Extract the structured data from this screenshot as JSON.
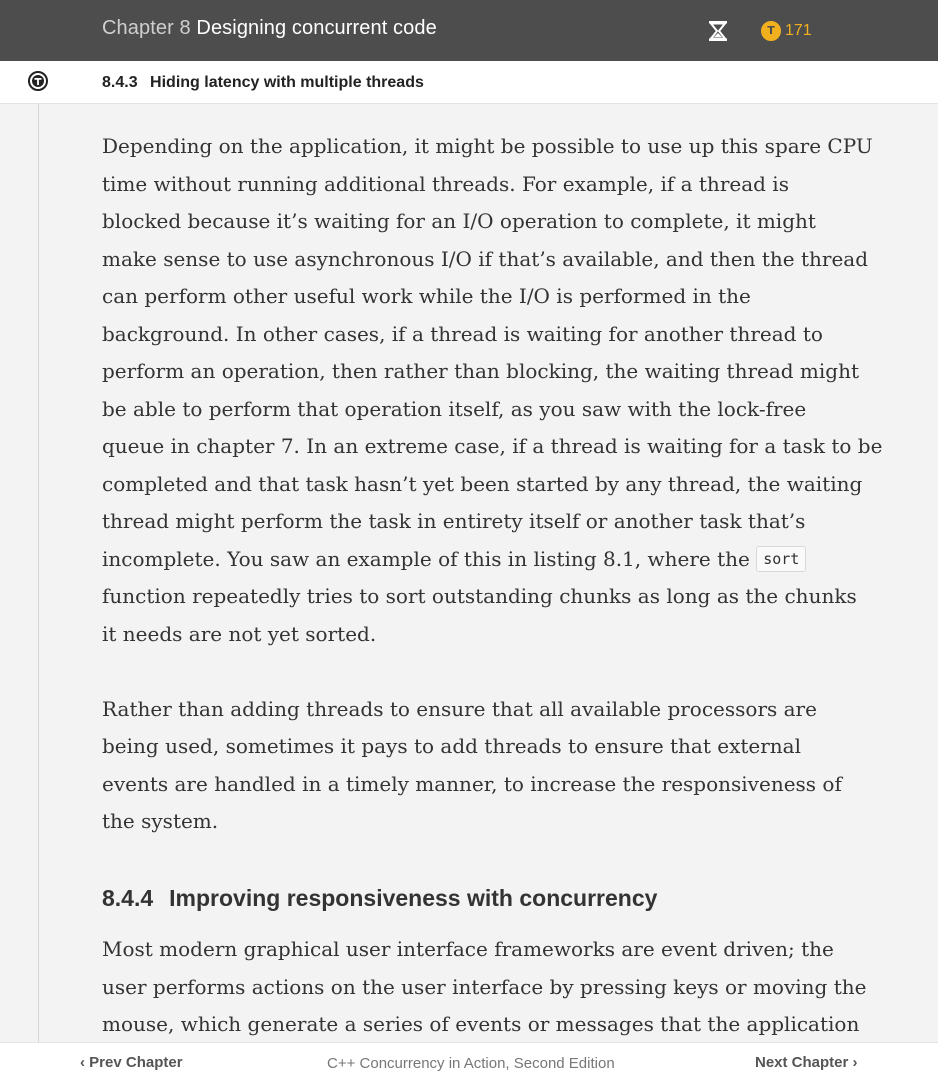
{
  "header": {
    "chapter_prefix": "Chapter 8",
    "chapter_title": "Designing concurrent code",
    "timer_icon": "hourglass-icon",
    "token_icon": "token-coin-icon",
    "token_count": "171"
  },
  "subheader": {
    "icon": "manning-logo-icon",
    "section_number": "8.4.3",
    "section_title": "Hiding latency with multiple threads"
  },
  "content": {
    "p1": [
      "Depending on the application, it might be possible to use up this spare CPU",
      "time without running additional threads. For example, if a thread is",
      "blocked because it’s waiting for an I/O operation to complete, it might",
      "make sense to use asynchronous I/O if that’s available, and then the thread",
      "can perform other useful work while the I/O is performed in the",
      "background. In other cases, if a thread is waiting for another thread to",
      "perform an operation, then rather than blocking, the waiting thread might",
      "be able to perform that operation itself, as you saw with the lock-free",
      "queue in chapter 7. In an extreme case, if a thread is waiting for a task to be",
      "completed and that task hasn’t yet been started by any thread, the waiting",
      "thread might perform the task in entirety itself or another task that’s"
    ],
    "p1_line12_before": "incomplete. You saw an example of this in listing 8.1, where the ",
    "p1_code": "sort",
    "p1_tail": [
      "function repeatedly tries to sort outstanding chunks as long as the chunks",
      "it needs are not yet sorted."
    ],
    "p2": [
      "Rather than adding threads to ensure that all available processors are",
      "being used, sometimes it pays to add threads to ensure that external",
      "events are handled in a timely manner, to increase the responsiveness of",
      "the system."
    ],
    "h_number": "8.4.4",
    "h_title": "Improving responsiveness with concurrency",
    "p3": [
      "Most modern graphical user interface frameworks are event driven; the",
      "user performs actions on the user interface by pressing keys or moving the",
      "mouse, which generate a series of events or messages that the application"
    ]
  },
  "footer": {
    "prev_label": "Prev Chapter",
    "book_title": "C++ Concurrency in Action, Second Edition",
    "next_label": "Next Chapter"
  }
}
